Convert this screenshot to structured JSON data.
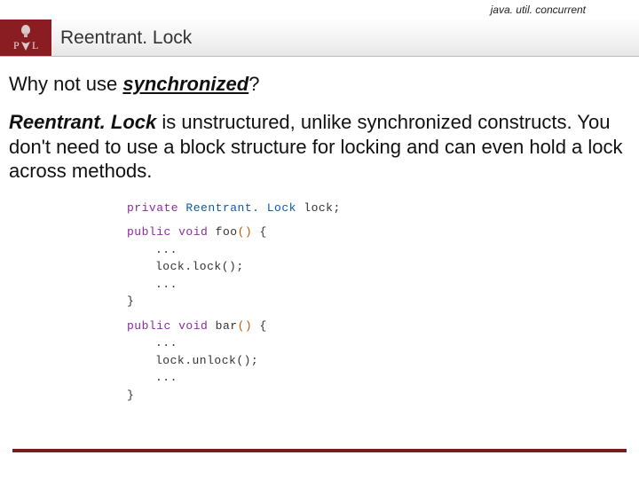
{
  "header": {
    "package": "java. util. concurrent",
    "title": "Reentrant. Lock"
  },
  "question": {
    "prefix": "Why not use ",
    "keyword": "synchronized",
    "suffix": "?"
  },
  "paragraph": {
    "emph": "Reentrant. Lock",
    "rest": " is unstructured, unlike synchronized constructs. You don't need to use a block structure for locking and can even hold a lock across methods."
  },
  "code": {
    "decl": {
      "mod": "private",
      "type": "Reentrant. Lock",
      "name": "lock;"
    },
    "foo": {
      "sig_mod": "public",
      "sig_ret": "void",
      "sig_name": "foo",
      "body": [
        "...",
        "lock.lock();",
        "..."
      ]
    },
    "bar": {
      "sig_mod": "public",
      "sig_ret": "void",
      "sig_name": "bar",
      "body": [
        "...",
        "lock.unlock();",
        "..."
      ]
    },
    "open_brace": "{",
    "close_brace": "}",
    "parens": "()"
  }
}
